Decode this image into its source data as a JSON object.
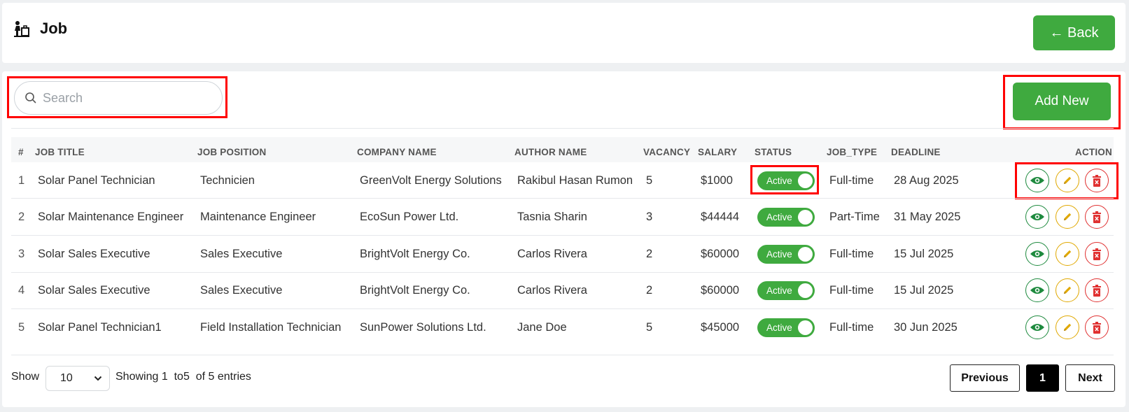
{
  "header": {
    "title": "Job",
    "back_label": "← Back"
  },
  "toolbar": {
    "search_placeholder": "Search",
    "add_label": "Add New"
  },
  "table": {
    "columns": [
      "#",
      "JOB TITLE",
      "JOB POSITION",
      "COMPANY NAME",
      "AUTHOR NAME",
      "VACANCY",
      "SALARY",
      "STATUS",
      "JOB_TYPE",
      "DEADLINE",
      "ACTION"
    ],
    "rows": [
      {
        "index": "1",
        "title": "Solar Panel Technician",
        "position": "Technicien",
        "company": "GreenVolt Energy Solutions",
        "author": "Rakibul Hasan Rumon",
        "vacancy": "5",
        "salary": "$1000",
        "status": "Active",
        "type": "Full-time",
        "deadline": "28 Aug 2025"
      },
      {
        "index": "2",
        "title": "Solar Maintenance Engineer",
        "position": "Maintenance Engineer",
        "company": "EcoSun Power Ltd.",
        "author": "Tasnia Sharin",
        "vacancy": "3",
        "salary": "$44444",
        "status": "Active",
        "type": "Part-Time",
        "deadline": "31 May 2025"
      },
      {
        "index": "3",
        "title": "Solar Sales Executive",
        "position": "Sales Executive",
        "company": "BrightVolt Energy Co.",
        "author": "Carlos Rivera",
        "vacancy": "2",
        "salary": "$60000",
        "status": "Active",
        "type": "Full-time",
        "deadline": "15 Jul 2025"
      },
      {
        "index": "4",
        "title": "Solar Sales Executive",
        "position": "Sales Executive",
        "company": "BrightVolt Energy Co.",
        "author": "Carlos Rivera",
        "vacancy": "2",
        "salary": "$60000",
        "status": "Active",
        "type": "Full-time",
        "deadline": "15 Jul 2025"
      },
      {
        "index": "5",
        "title": "Solar Panel Technician1",
        "position": "Field Installation Technician",
        "company": "SunPower Solutions Ltd.",
        "author": "Jane Doe",
        "vacancy": "5",
        "salary": "$45000",
        "status": "Active",
        "type": "Full-time",
        "deadline": "30 Jun 2025"
      }
    ]
  },
  "footer": {
    "show_label": "Show",
    "page_size": "10",
    "info": "Showing 1  to5  of 5 entries",
    "prev_label": "Previous",
    "current_page": "1",
    "next_label": "Next"
  },
  "colors": {
    "primary": "#3faa3f",
    "view": "#1e8a3e",
    "edit": "#e0a800",
    "delete": "#e03131",
    "highlight": "#ff0000"
  },
  "icons": {
    "page": "job-seeker-icon",
    "search": "search-icon",
    "view": "eye-icon",
    "edit": "pencil-icon",
    "delete": "trash-icon",
    "select": "chevron-down-icon"
  }
}
